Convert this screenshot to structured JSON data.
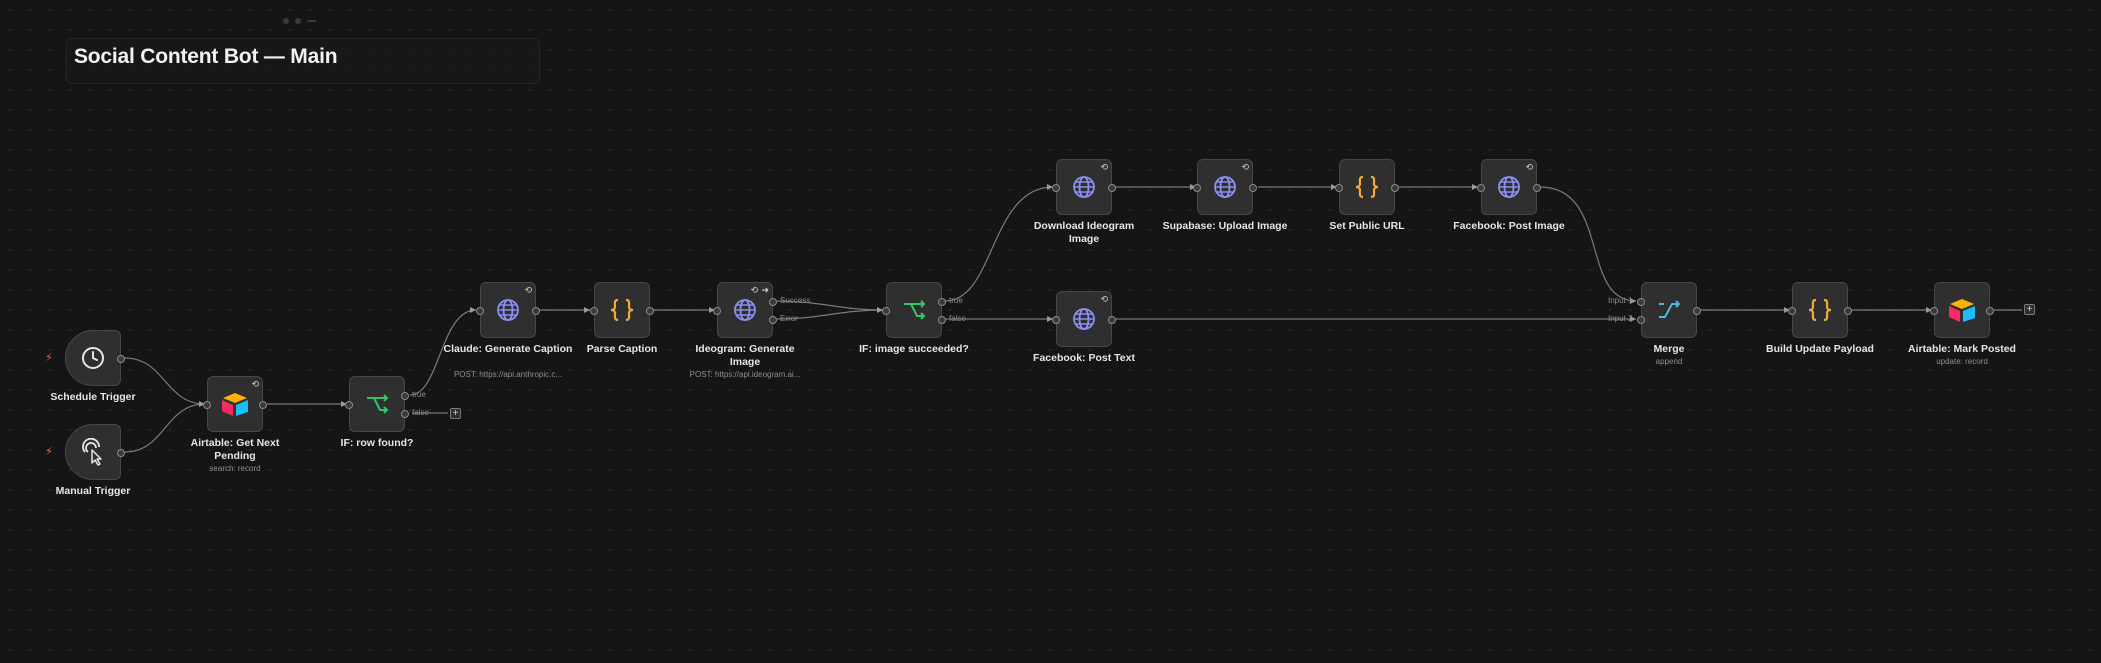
{
  "workflow": {
    "title": "Social Content Bot — Main"
  },
  "nodes": {
    "schedule_trigger": {
      "label": "Schedule Trigger",
      "icon": "clock-icon"
    },
    "manual_trigger": {
      "label": "Manual Trigger",
      "icon": "pointer-click-icon"
    },
    "airtable_get": {
      "label": "Airtable: Get Next Pending",
      "subtitle": "search: record",
      "icon": "airtable-icon"
    },
    "if_row_found": {
      "label": "IF: row found?",
      "outputs": [
        "true",
        "false"
      ],
      "icon": "if-branch-icon"
    },
    "claude_caption": {
      "label": "Claude: Generate Caption",
      "subtitle": "POST: https://api.anthropic.c...",
      "icon": "globe-icon"
    },
    "parse_caption": {
      "label": "Parse Caption",
      "icon": "code-braces-icon"
    },
    "ideogram_generate": {
      "label": "Ideogram: Generate Image",
      "subtitle": "POST: https://api.ideogram.ai...",
      "outputs": [
        "Success",
        "Error"
      ],
      "icon": "globe-icon"
    },
    "if_image_succeeded": {
      "label": "IF: image succeeded?",
      "outputs": [
        "true",
        "false"
      ],
      "icon": "if-branch-icon"
    },
    "download_ideogram": {
      "label": "Download Ideogram Image",
      "icon": "globe-icon"
    },
    "supabase_upload": {
      "label": "Supabase: Upload Image",
      "icon": "globe-icon"
    },
    "set_public_url": {
      "label": "Set Public URL",
      "icon": "code-braces-icon"
    },
    "facebook_post_image": {
      "label": "Facebook: Post Image",
      "icon": "globe-icon"
    },
    "facebook_post_text": {
      "label": "Facebook: Post Text",
      "icon": "globe-icon"
    },
    "merge": {
      "label": "Merge",
      "subtitle": "append",
      "inputs": [
        "Input 1",
        "Input 2"
      ],
      "icon": "merge-icon"
    },
    "build_update_payload": {
      "label": "Build Update Payload",
      "icon": "code-braces-icon"
    },
    "airtable_mark_posted": {
      "label": "Airtable: Mark Posted",
      "subtitle": "update: record",
      "icon": "airtable-icon"
    }
  },
  "colors": {
    "canvas": "#151515",
    "node_bg": "#2f2f2f",
    "node_border": "#474747",
    "wire": "#7a7a7a",
    "trigger_bolt": "#ff5a4e",
    "http_icon": "#8b8ff0",
    "code_icon": "#f4a83a",
    "if_icon": "#35c46a",
    "merge_icon": "#4fb7e0"
  }
}
